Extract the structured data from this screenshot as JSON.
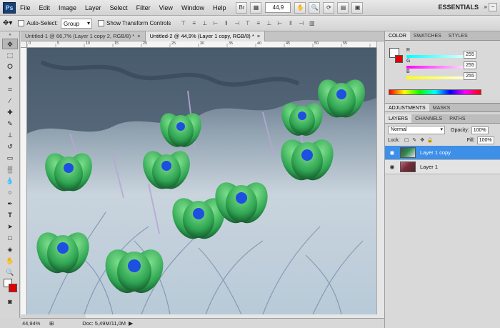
{
  "menubar": {
    "logo": "Ps",
    "items": [
      "File",
      "Edit",
      "Image",
      "Layer",
      "Select",
      "Filter",
      "View",
      "Window",
      "Help"
    ],
    "bridge_label": "Br",
    "zoom": "44,9",
    "workspace": "ESSENTIALS"
  },
  "options": {
    "auto_select_label": "Auto-Select:",
    "auto_select_value": "Group",
    "transform_label": "Show Transform Controls"
  },
  "tabs": [
    {
      "title": "Untitled-1 @ 66,7% (Layer 1 copy 2, RGB/8) *",
      "close": "×"
    },
    {
      "title": "Untitled-2 @ 44,9% (Layer 1 copy, RGB/8) *",
      "close": "×"
    }
  ],
  "ruler_top": [
    "0",
    "5",
    "10",
    "15",
    "20",
    "25",
    "30",
    "35",
    "40",
    "45",
    "50",
    "55"
  ],
  "status": {
    "zoom": "44,94%",
    "doc": "Doc: 5,49M/11,0M"
  },
  "color_panel": {
    "tabs": [
      "COLOR",
      "SWATCHES",
      "STYLES"
    ],
    "r_label": "R",
    "r_value": "255",
    "g_label": "G",
    "g_value": "255",
    "b_label": "B",
    "b_value": "255"
  },
  "adjust_tabs": [
    "ADJUSTMENTS",
    "MASKS"
  ],
  "layers_panel": {
    "tabs": [
      "LAYERS",
      "CHANNELS",
      "PATHS"
    ],
    "blend_mode": "Normal",
    "opacity_label": "Opacity:",
    "opacity": "100%",
    "lock_label": "Lock:",
    "fill_label": "Fill:",
    "fill": "100%",
    "layers": [
      {
        "name": "Layer 1 copy",
        "selected": true
      },
      {
        "name": "Layer 1",
        "selected": false
      }
    ]
  },
  "colors": {
    "selection_blue": "#3e8fe8",
    "background_swatch": "#e00000",
    "foreground_swatch": "#ffffff"
  }
}
